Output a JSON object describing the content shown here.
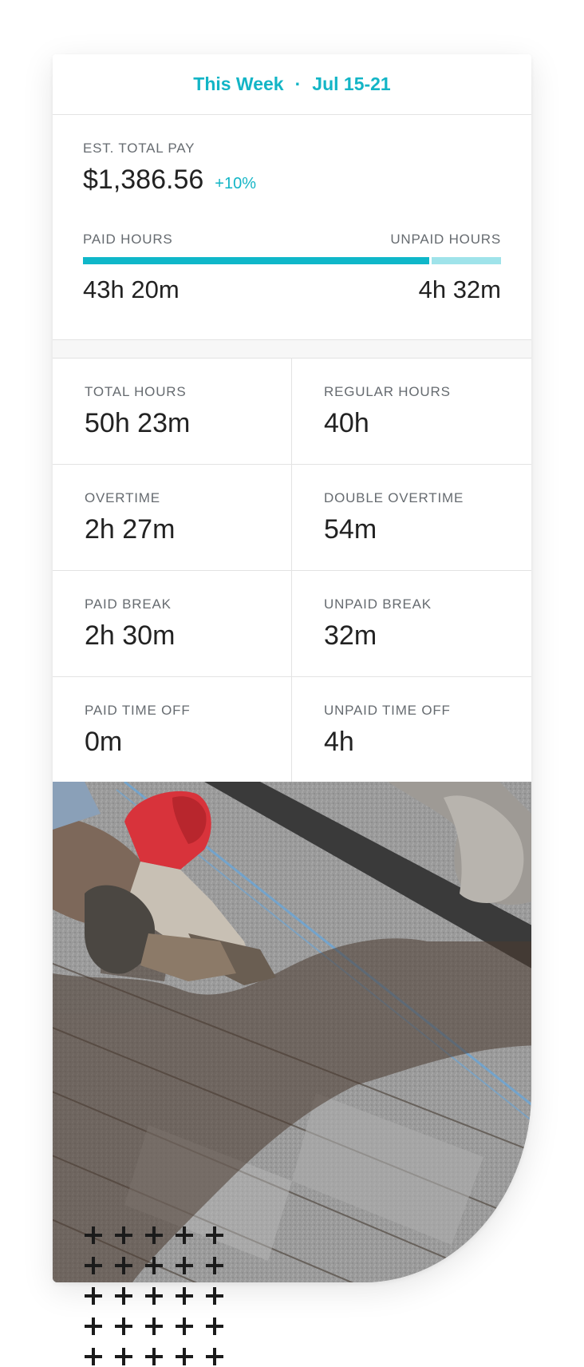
{
  "header": {
    "period": "This Week",
    "separator": "·",
    "date_range": "Jul 15-21"
  },
  "pay": {
    "label": "EST. TOTAL PAY",
    "amount": "$1,386.56",
    "change": "+10%"
  },
  "hours": {
    "paid_label": "PAID HOURS",
    "unpaid_label": "UNPAID HOURS",
    "paid_value": "43h 20m",
    "unpaid_value": "4h 32m",
    "paid_fraction": 0.83,
    "bar_color": "#0fb7c9",
    "bar_track_color": "#9fe3ea"
  },
  "stats": [
    {
      "label": "TOTAL HOURS",
      "value": "50h 23m"
    },
    {
      "label": "REGULAR HOURS",
      "value": "40h"
    },
    {
      "label": "OVERTIME",
      "value": "2h 27m"
    },
    {
      "label": "DOUBLE OVERTIME",
      "value": "54m"
    },
    {
      "label": "PAID BREAK",
      "value": "2h 30m"
    },
    {
      "label": "UNPAID BREAK",
      "value": "32m"
    },
    {
      "label": "PAID TIME OFF",
      "value": "0m"
    },
    {
      "label": "UNPAID TIME OFF",
      "value": "4h"
    }
  ],
  "photo": {
    "subject": "roofer-nail-gun-shingles"
  },
  "colors": {
    "accent": "#13b5c6",
    "text": "#222222",
    "label": "#666b70"
  }
}
